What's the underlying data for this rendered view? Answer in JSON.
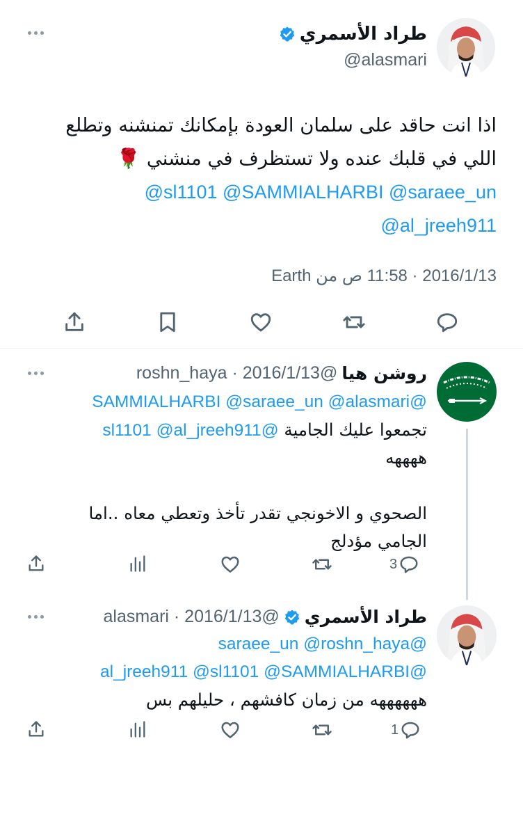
{
  "main_tweet": {
    "author_name": "طراد الأسمري",
    "handle": "@alasmari",
    "verified": true,
    "text_lines": [
      "اذا انت حاقد على سلمان العودة بإمكانك تمنشنه وتطلع",
      "اللي في قلبك عنده ولا تستظرف في منشني 🌹"
    ],
    "mention_lines": [
      "@sl1101 @SAMMIALHARBI @saraee_un",
      "@al_jreeh911"
    ],
    "meta": "2016/1/13 · 11:58 ص من Earth",
    "actions": {
      "reply_icon": "reply-icon",
      "retweet_icon": "retweet-icon",
      "like_icon": "heart-icon",
      "bookmark_icon": "bookmark-icon",
      "share_icon": "share-icon"
    }
  },
  "replies": [
    {
      "author_name": "روشن هيا",
      "handle_date": "@roshn_haya · 2016/1/13",
      "verified": false,
      "lines": [
        {
          "text": "@SAMMIALHARBI @saraee_un @alasmari",
          "type": "mention"
        },
        {
          "text": "@al_jreeh911 @sl1101 تجمعوا عليك الجامية",
          "type": "mixed"
        },
        {
          "text": "ههههه",
          "type": "text"
        },
        {
          "text": "",
          "type": "blank"
        },
        {
          "text": "الصحوي و الاخونجي تقدر تأخذ وتعطي معاه ..اما",
          "type": "text"
        },
        {
          "text": "الجامي مؤدلج",
          "type": "text"
        }
      ],
      "reply_count": "3",
      "retweet_count": "",
      "like_count": ""
    },
    {
      "author_name": "طراد الأسمري",
      "handle_date": "@alasmari · 2016/1/13",
      "verified": true,
      "lines": [
        {
          "text": "@saraee_un @roshn_haya",
          "type": "mention"
        },
        {
          "text": "@al_jreeh911 @sl1101 @SAMMIALHARBI",
          "type": "mention"
        },
        {
          "text": "ههههههه من زمان كافشهم ، حليلهم بس",
          "type": "text"
        }
      ],
      "reply_count": "1",
      "retweet_count": "",
      "like_count": ""
    }
  ],
  "colors": {
    "accent": "#1d9bf0",
    "text": "#0f1419",
    "secondary": "#536471",
    "divider": "#eff3f4",
    "flag_green": "#006c35"
  }
}
